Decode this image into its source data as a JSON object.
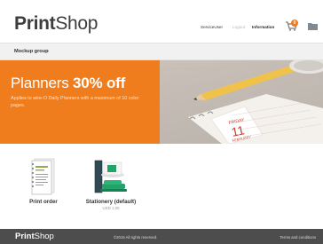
{
  "app": {
    "logo_bold": "Print",
    "logo_light": "Shop"
  },
  "header": {
    "links": {
      "service": "ServiceUser",
      "logout": "Logout",
      "information": "Information"
    },
    "cart_count": "0",
    "icons": [
      "cart-icon",
      "folder-icon"
    ]
  },
  "breadcrumb": {
    "label": "Mockup group",
    "arrow": "›"
  },
  "promo": {
    "title_light": "Planners ",
    "title_bold": "30% off",
    "subtitle": "Applies to wire-O Daily Planners with a maximum of 10 color pages.",
    "calendar_month": "FRIDAY",
    "calendar_day": "11",
    "calendar_label": "FEBRUARY"
  },
  "products": [
    {
      "title": "Print order",
      "price": ""
    },
    {
      "title": "Stationery (default)",
      "price": "USD 1.00"
    }
  ],
  "footer": {
    "logo_bold": "Print",
    "logo_light": "Shop",
    "copyright": "©2016 All rights reserved.",
    "terms": "Terms and conditions"
  },
  "colors": {
    "accent": "#ef7d1e",
    "footer_bg": "#4d4d4d",
    "crumb_bg": "#f1f1f1"
  }
}
